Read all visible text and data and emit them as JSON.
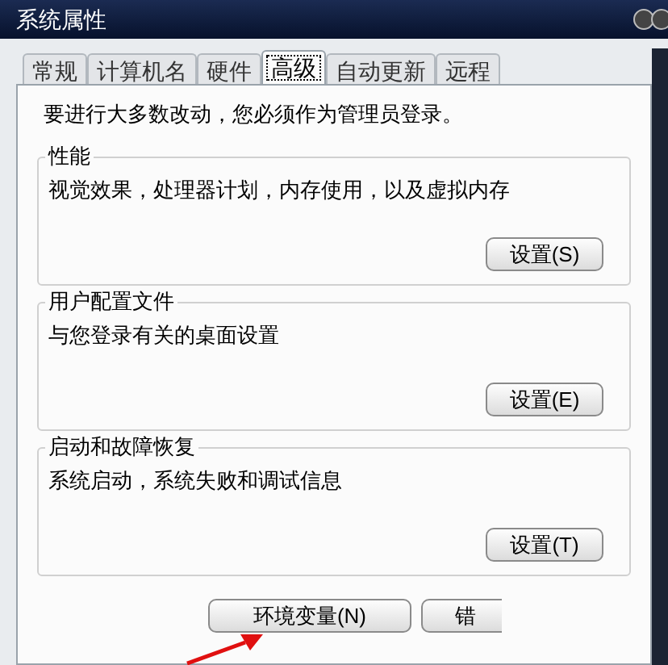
{
  "window": {
    "title": "系统属性"
  },
  "tabs": [
    {
      "label": "常规",
      "selected": false
    },
    {
      "label": "计算机名",
      "selected": false
    },
    {
      "label": "硬件",
      "selected": false
    },
    {
      "label": "高级",
      "selected": true
    },
    {
      "label": "自动更新",
      "selected": false
    },
    {
      "label": "远程",
      "selected": false
    }
  ],
  "notice": "要进行大多数改动，您必须作为管理员登录。",
  "groups": [
    {
      "title": "性能",
      "description": "视觉效果，处理器计划，内存使用，以及虚拟内存",
      "button": "设置(S)"
    },
    {
      "title": "用户配置文件",
      "description": "与您登录有关的桌面设置",
      "button": "设置(E)"
    },
    {
      "title": "启动和故障恢复",
      "description": "系统启动，系统失败和调试信息",
      "button": "设置(T)"
    }
  ],
  "bottom_buttons": [
    "环境变量(N)",
    "错"
  ]
}
